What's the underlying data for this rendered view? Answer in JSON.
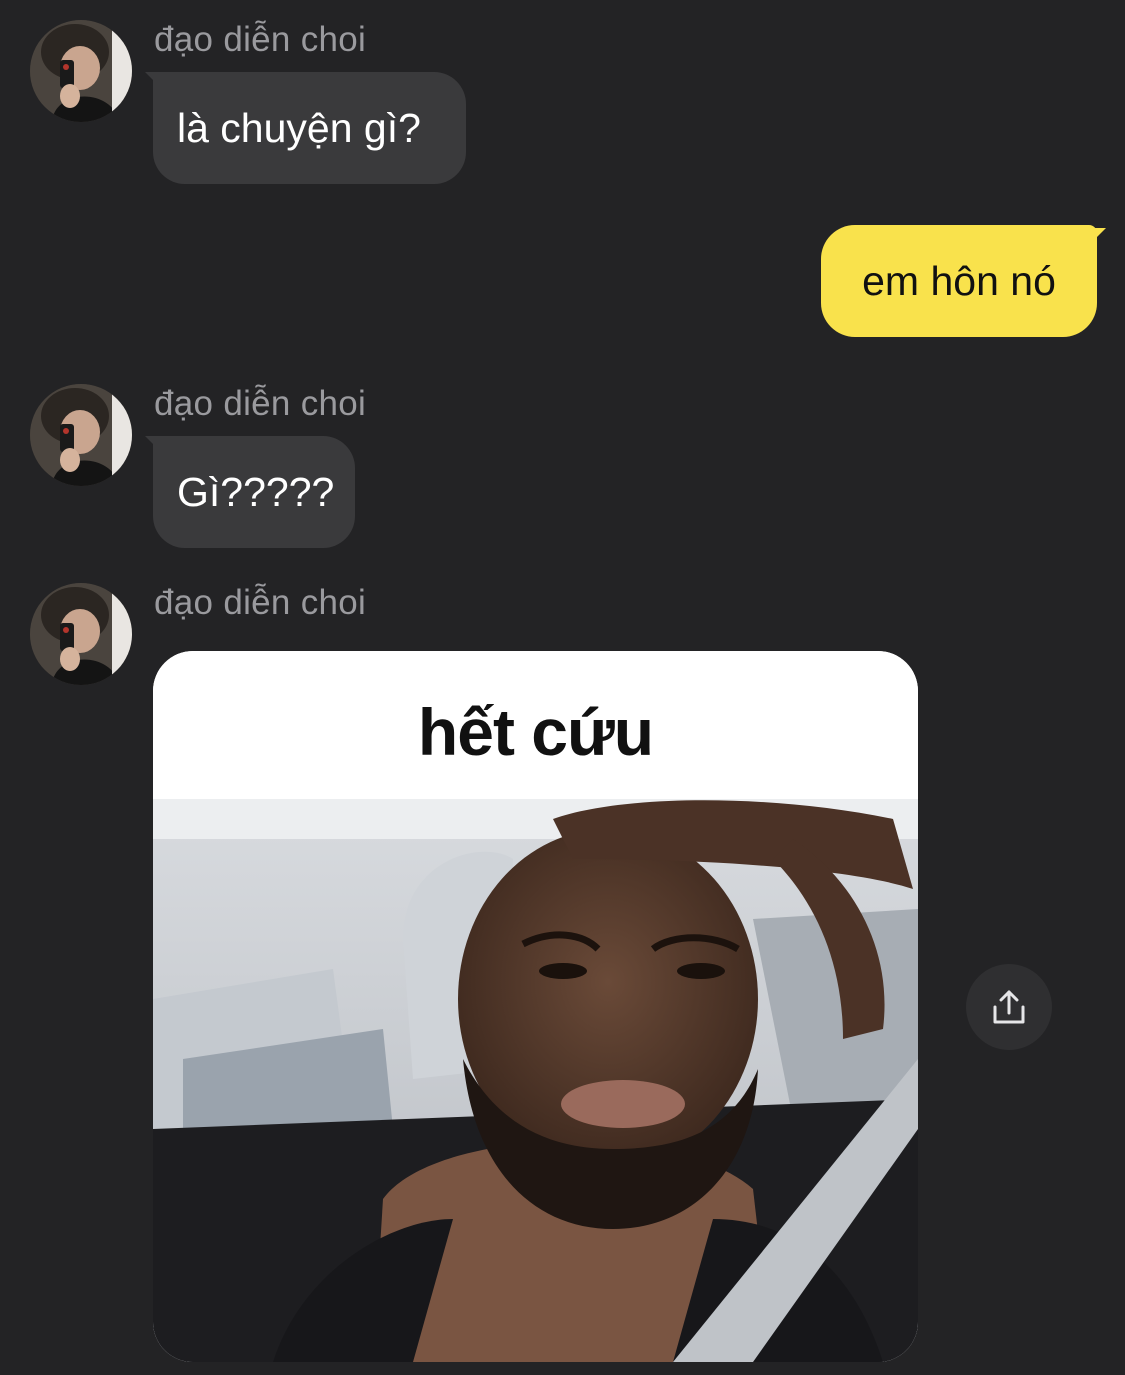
{
  "conversation": {
    "messages": [
      {
        "direction": "incoming",
        "sender": "đạo diễn choi",
        "text": "là chuyện gì?"
      },
      {
        "direction": "outgoing",
        "text": "em hôn nó"
      },
      {
        "direction": "incoming",
        "sender": "đạo diễn choi",
        "text": "Gì?????"
      },
      {
        "direction": "incoming",
        "sender": "đạo diễn choi",
        "type": "image",
        "caption": "hết cứu"
      }
    ]
  },
  "icons": {
    "share": "share-icon",
    "avatar": "avatar"
  },
  "colors": {
    "background": "#232325",
    "incoming_bubble": "#3a3a3c",
    "outgoing_bubble": "#f9e24c",
    "sender_name": "#9a9a9e"
  }
}
